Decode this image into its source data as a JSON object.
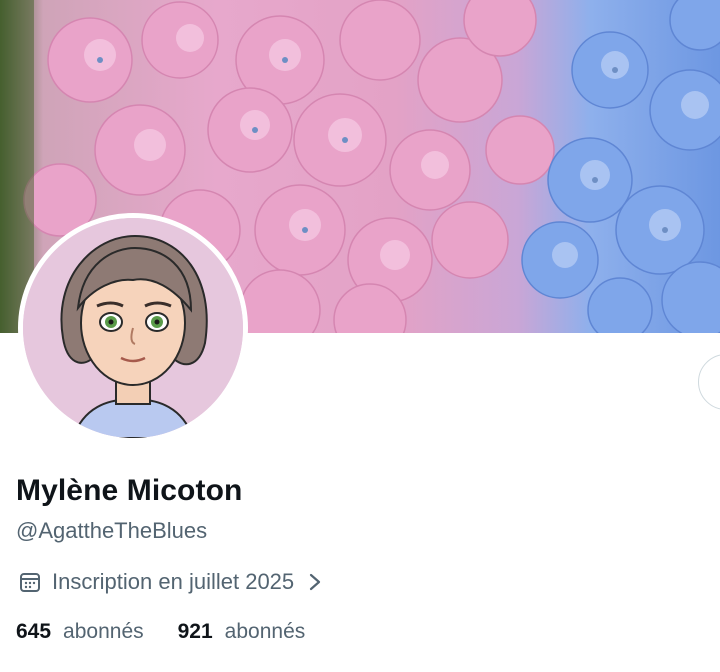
{
  "profile": {
    "display_name": "Mylène Micoton",
    "handle": "@AgattheTheBlues",
    "joined": "Inscription en juillet 2025",
    "banner_image": "pink-and-blue-hydrangea-photo",
    "avatar_image": "illustrated-woman-bob-haircut-green-eyes"
  },
  "stats": [
    {
      "value": "645",
      "label": "abonnés"
    },
    {
      "value": "921",
      "label": "abonnés"
    }
  ],
  "icons": {
    "joined": "calendar-icon",
    "joined_more": "chevron-right-icon"
  },
  "colors": {
    "text_primary": "#0f1419",
    "text_secondary": "#536471"
  }
}
